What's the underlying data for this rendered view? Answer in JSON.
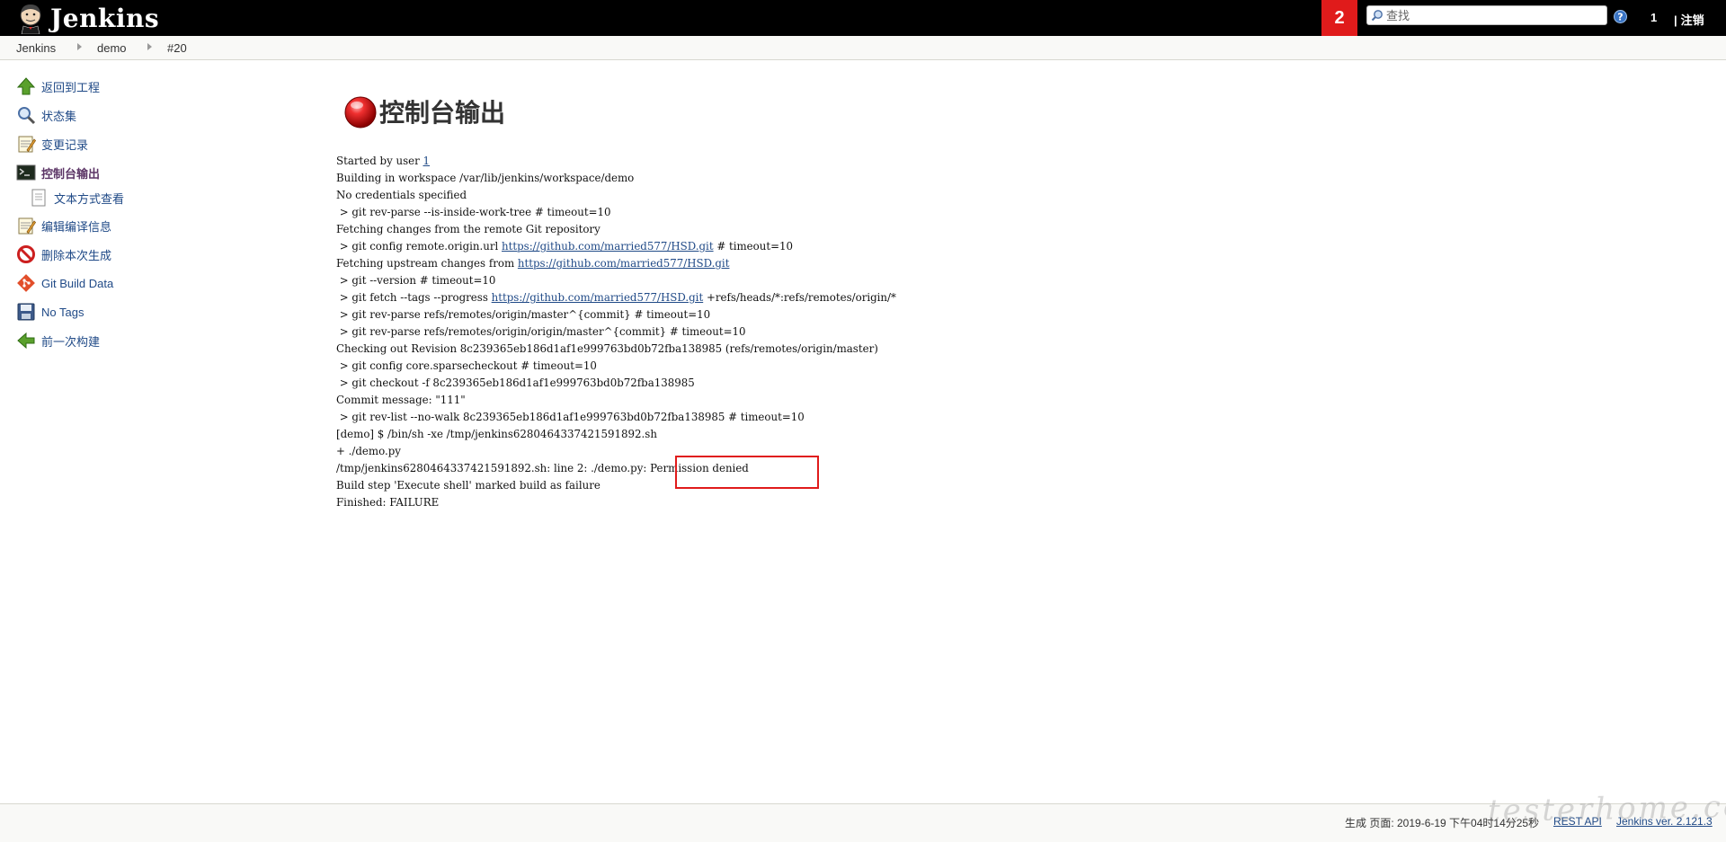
{
  "header": {
    "app_name": "Jenkins",
    "build_queue_badge": "2",
    "search_placeholder": "查找",
    "user": "1",
    "separator": "|",
    "logout": "注销"
  },
  "breadcrumb": {
    "items": [
      "Jenkins",
      "demo",
      "#20"
    ]
  },
  "sidebar": {
    "items": [
      {
        "label": "返回到工程",
        "icon": "up-arrow-icon"
      },
      {
        "label": "状态集",
        "icon": "magnifier-icon"
      },
      {
        "label": "变更记录",
        "icon": "notepad-icon"
      },
      {
        "label": "控制台输出",
        "icon": "terminal-icon",
        "active": true
      },
      {
        "label": "文本方式查看",
        "icon": "document-icon"
      },
      {
        "label": "编辑编译信息",
        "icon": "notepad-icon"
      },
      {
        "label": "删除本次生成",
        "icon": "no-entry-icon"
      },
      {
        "label": "Git Build Data",
        "icon": "git-icon"
      },
      {
        "label": "No Tags",
        "icon": "floppy-icon"
      },
      {
        "label": "前一次构建",
        "icon": "left-arrow-icon"
      }
    ]
  },
  "main": {
    "title": "控制台输出",
    "status_color": "#e01b1b"
  },
  "console": {
    "started_prefix": "Started by user ",
    "started_user": "1",
    "repo_url": "https://github.com/married577/HSD.git",
    "lines": [
      "Building in workspace /var/lib/jenkins/workspace/demo",
      "No credentials specified",
      " > git rev-parse --is-inside-work-tree # timeout=10",
      "Fetching changes from the remote Git repository",
      " > git config remote.origin.url ",
      " # timeout=10",
      "Fetching upstream changes from ",
      " > git --version # timeout=10",
      " > git fetch --tags --progress ",
      " +refs/heads/*:refs/remotes/origin/*",
      " > git rev-parse refs/remotes/origin/master^{commit} # timeout=10",
      " > git rev-parse refs/remotes/origin/origin/master^{commit} # timeout=10",
      "Checking out Revision 8c239365eb186d1af1e999763bd0b72fba138985 (refs/remotes/origin/master)",
      " > git config core.sparsecheckout # timeout=10",
      " > git checkout -f 8c239365eb186d1af1e999763bd0b72fba138985",
      "Commit message: \"111\"",
      " > git rev-list --no-walk 8c239365eb186d1af1e999763bd0b72fba138985 # timeout=10",
      "[demo] $ /bin/sh -xe /tmp/jenkins6280464337421591892.sh",
      "+ ./demo.py",
      "/tmp/jenkins6280464337421591892.sh: line 2: ./demo.py: Permission denied",
      "Build step 'Execute shell' marked build as failure",
      "Finished: FAILURE"
    ]
  },
  "footer": {
    "generated": "生成 页面: 2019-6-19 下午04时14分25秒",
    "rest_api": "REST API",
    "version": "Jenkins ver. 2.121.3"
  },
  "watermark": "testerhome.com"
}
